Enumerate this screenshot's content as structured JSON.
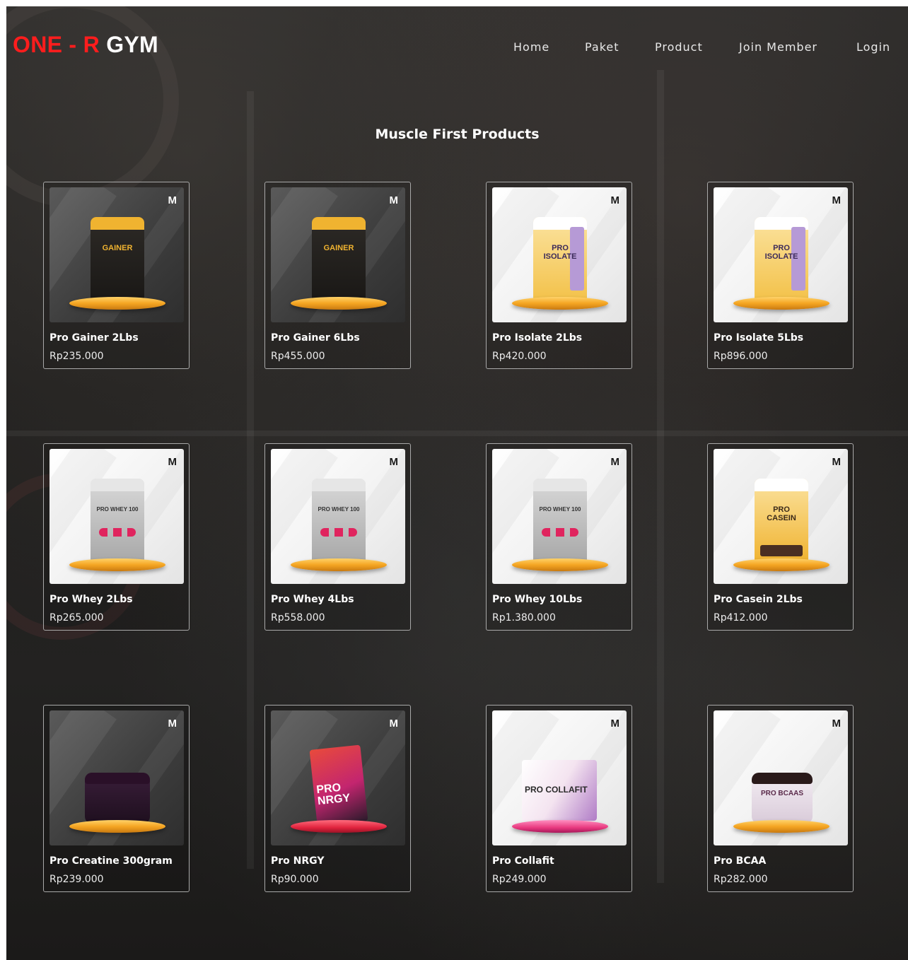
{
  "brand": {
    "part1": "ONE - R",
    "part2": "GYM"
  },
  "nav": [
    {
      "label": "Home"
    },
    {
      "label": "Paket"
    },
    {
      "label": "Product"
    },
    {
      "label": "Join Member"
    },
    {
      "label": "Login"
    }
  ],
  "page_title": "Muscle First Products",
  "product_brand_mark": "M",
  "products": [
    {
      "name": "Pro Gainer 2Lbs",
      "price": "Rp235.000",
      "pack_label": "GAINER",
      "pack": "gainer-pouch"
    },
    {
      "name": "Pro Gainer 6Lbs",
      "price": "Rp455.000",
      "pack_label": "GAINER",
      "pack": "gainer-pouch"
    },
    {
      "name": "Pro Isolate 2Lbs",
      "price": "Rp420.000",
      "pack_label": "PRO ISOLATE",
      "pack": "isolate-pouch"
    },
    {
      "name": "Pro Isolate 5Lbs",
      "price": "Rp896.000",
      "pack_label": "PRO ISOLATE",
      "pack": "isolate-pouch"
    },
    {
      "name": "Pro Whey 2Lbs",
      "price": "Rp265.000",
      "pack_label": "PRO WHEY 100",
      "pack": "whey-pouch"
    },
    {
      "name": "Pro Whey 4Lbs",
      "price": "Rp558.000",
      "pack_label": "PRO WHEY 100",
      "pack": "whey-pouch"
    },
    {
      "name": "Pro Whey 10Lbs",
      "price": "Rp1.380.000",
      "pack_label": "PRO WHEY 100",
      "pack": "whey-pouch"
    },
    {
      "name": "Pro Casein 2Lbs",
      "price": "Rp412.000",
      "pack_label": "PRO CASEIN",
      "pack": "casein-pouch"
    },
    {
      "name": "Pro Creatine 300gram",
      "price": "Rp239.000",
      "pack_label": "",
      "pack": "creatine-tub"
    },
    {
      "name": "Pro NRGY",
      "price": "Rp90.000",
      "pack_label": "PRO NRGY",
      "pack": "nrgy-box"
    },
    {
      "name": "Pro Collafit",
      "price": "Rp249.000",
      "pack_label": "PRO COLLAFIT",
      "pack": "collafit-box"
    },
    {
      "name": "Pro BCAA",
      "price": "Rp282.000",
      "pack_label": "PRO BCAAS",
      "pack": "bcaa-tub"
    }
  ],
  "colors": {
    "brand_red": "#ff1d1d",
    "accent_gold": "#f5a623",
    "background": "#232221"
  }
}
